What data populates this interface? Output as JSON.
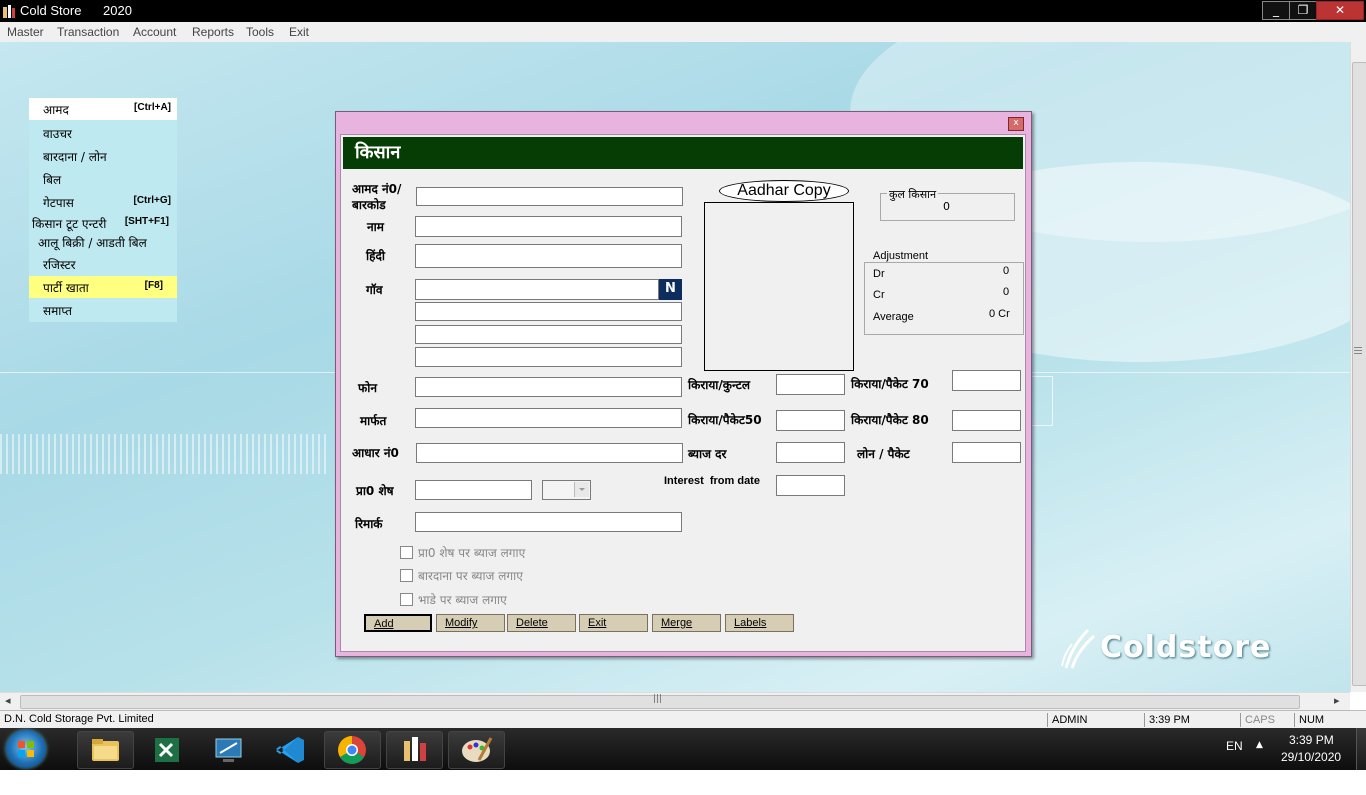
{
  "window": {
    "title": "Cold Store",
    "year": "2020",
    "minimize": "_",
    "restore": "❐",
    "close": "✕"
  },
  "menubar": [
    "Master",
    "Transaction",
    "Account",
    "Reports",
    "Tools",
    "Exit"
  ],
  "left_menu": [
    {
      "label": "आमद",
      "shortcut": "[Ctrl+A]"
    },
    {
      "label": "वाउचर",
      "shortcut": ""
    },
    {
      "label": "बारदाना / लोन",
      "shortcut": ""
    },
    {
      "label": "बिल",
      "shortcut": ""
    },
    {
      "label": "गेटपास",
      "shortcut": "[Ctrl+G]"
    },
    {
      "label": "किसान टूट एन्टरी",
      "shortcut": "[SHT+F1]"
    },
    {
      "label": "आलू बिक्री / आडती बिल",
      "shortcut": ""
    },
    {
      "label": "रजिस्टर",
      "shortcut": ""
    },
    {
      "label": "पार्टी खाता",
      "shortcut": "[F8]"
    },
    {
      "label": "समाप्त",
      "shortcut": ""
    }
  ],
  "dialog": {
    "close": "x",
    "header": "किसान",
    "labels": {
      "amad_no": "आमद नं0/",
      "barcode": "बारकोड",
      "name": "नाम",
      "hindi": "हिंदी",
      "village": "गॉव",
      "phone": "फोन",
      "marfat": "मार्फत",
      "aadhar_no": "आधार नं0",
      "prev_balance": "प्रा0 शेष",
      "remark": "रिमार्क",
      "rent_quintal": "किराया/कुन्टल",
      "rent_packet50": "किराया/पैकेट50",
      "interest_rate": "ब्याज दर",
      "interest_from_date": "Interest  from date",
      "rent_packet70": "किराया/पैकेट 70",
      "rent_packet80": "किराया/पैकेट 80",
      "loan_packet": "लोन / पैकेट"
    },
    "values": {
      "amad_no": "",
      "name": "",
      "hindi": "",
      "village1": "",
      "village2": "",
      "village3": "",
      "village4": "",
      "phone": "",
      "marfat": "",
      "aadhar_no": "",
      "prev_balance": "",
      "prev_balance_type": "",
      "remark": "",
      "rent_quintal": "",
      "rent_packet50": "",
      "interest_rate": "",
      "interest_from_date": "",
      "rent_packet70": "",
      "rent_packet80": "",
      "loan_packet": ""
    },
    "village_button": "N",
    "aadhar_copy": "Aadhar Copy",
    "total_farmers": {
      "title": "कुल किसान",
      "value": "0"
    },
    "adjustment": {
      "title": "Adjustment",
      "dr_label": "Dr",
      "dr_value": "0",
      "cr_label": "Cr",
      "cr_value": "0",
      "avg_label": "Average",
      "avg_value": "0 Cr"
    },
    "checkboxes": [
      "प्रा0 शेष पर ब्याज लगाए",
      "बारदाना पर ब्याज लगाए",
      "भाडे पर ब्याज लगाए"
    ],
    "buttons": [
      "Add",
      "Modify",
      "Delete",
      "Exit",
      "Merge",
      "Labels"
    ]
  },
  "logo": "Coldstore",
  "status": {
    "company": "D.N. Cold Storage Pvt. Limited",
    "user": "ADMIN",
    "time": "3:39 PM",
    "caps": "CAPS",
    "num": "NUM"
  },
  "tray": {
    "lang": "EN",
    "time": "3:39 PM",
    "date": "29/10/2020"
  },
  "scroll": {
    "grip": "|||",
    "left": "◂",
    "right": "▸"
  }
}
